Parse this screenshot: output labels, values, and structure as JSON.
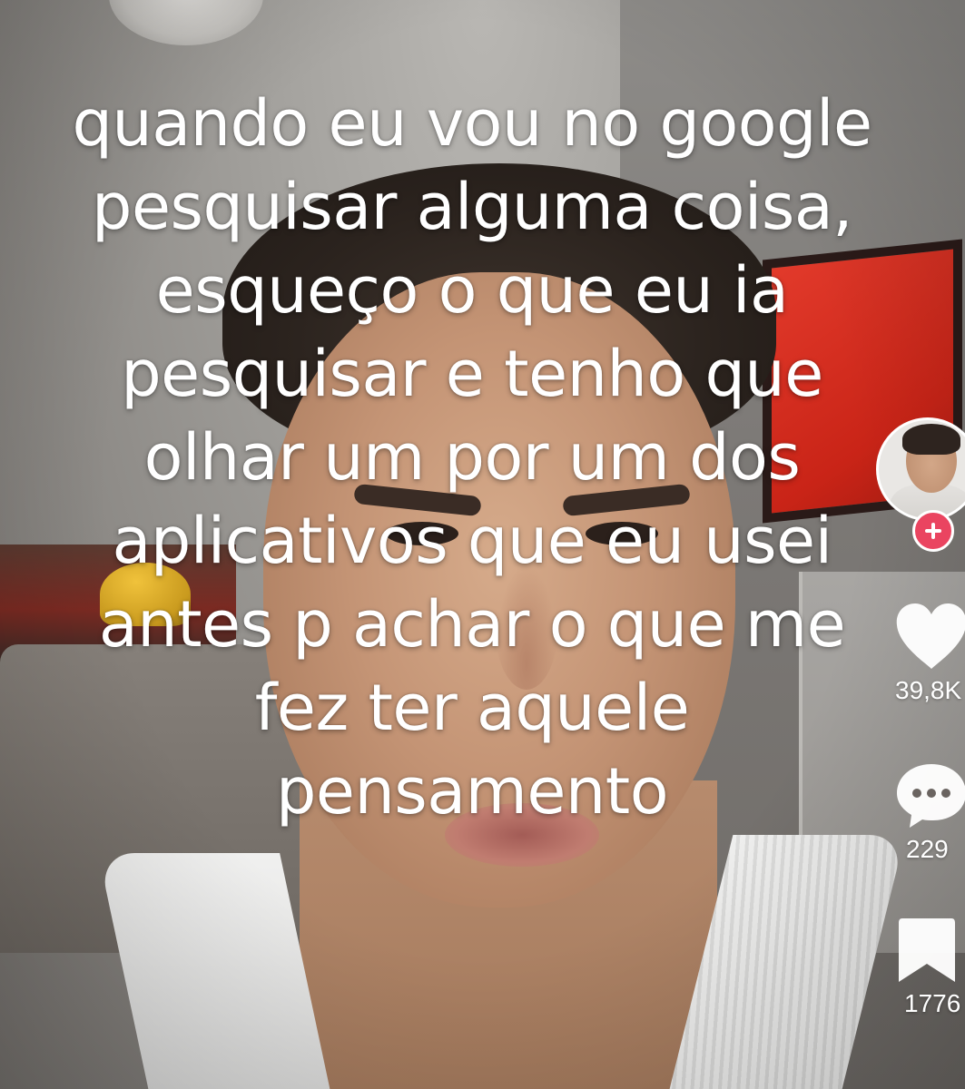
{
  "caption": {
    "lines": [
      "quando eu vou no google",
      "pesquisar alguma coisa,",
      "esqueço o que eu ia",
      "pesquisar e tenho que",
      "olhar um por um dos",
      "aplicativos que eu usei",
      "antes p achar o que me",
      "fez ter aquele",
      "pensamento"
    ]
  },
  "rail": {
    "avatar_icon": "creator-avatar",
    "follow_icon": "plus-icon",
    "like": {
      "icon": "heart-icon",
      "count": "39,8K"
    },
    "comment": {
      "icon": "comment-bubble-icon",
      "count": "229"
    },
    "save": {
      "icon": "bookmark-icon",
      "count": "1776"
    }
  },
  "colors": {
    "follow_button": "#ea4460",
    "icon_fill": "#ffffff",
    "caption_text": "#ffffff"
  }
}
